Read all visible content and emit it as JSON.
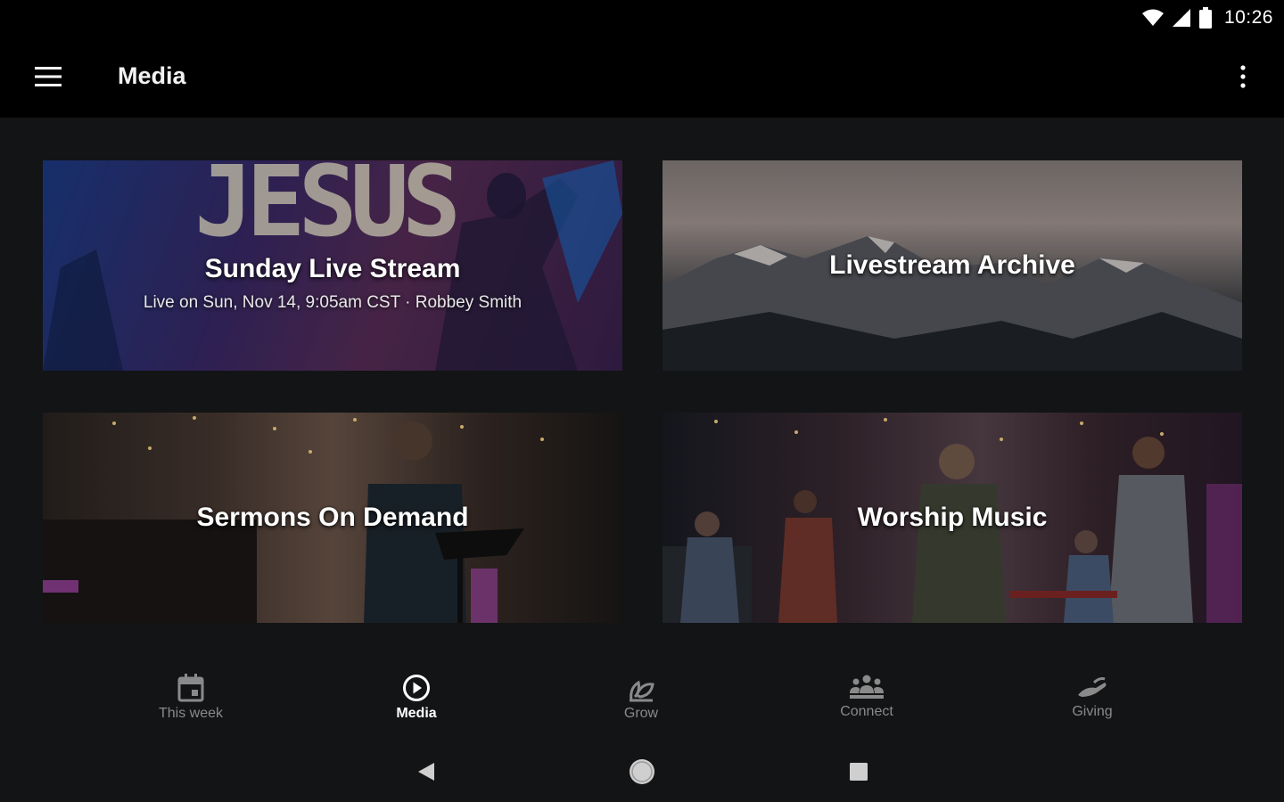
{
  "status": {
    "time": "10:26"
  },
  "appbar": {
    "title": "Media"
  },
  "cards": [
    {
      "title": "Sunday Live Stream",
      "subtitle": "Live on Sun, Nov 14, 9:05am CST · Robbey Smith",
      "background_text": "JESUS"
    },
    {
      "title": "Livestream Archive"
    },
    {
      "title": "Sermons On Demand"
    },
    {
      "title": "Worship Music"
    }
  ],
  "bottom_nav": {
    "active": "Media",
    "items": [
      {
        "label": "This week",
        "icon": "calendar-icon"
      },
      {
        "label": "Media",
        "icon": "play-circle-icon"
      },
      {
        "label": "Grow",
        "icon": "sprout-icon"
      },
      {
        "label": "Connect",
        "icon": "group-icon"
      },
      {
        "label": "Giving",
        "icon": "hand-give-icon"
      }
    ]
  },
  "colors": {
    "background": "#121415",
    "appbar": "#000000",
    "inactive": "#8a8a8a",
    "active": "#ffffff"
  }
}
